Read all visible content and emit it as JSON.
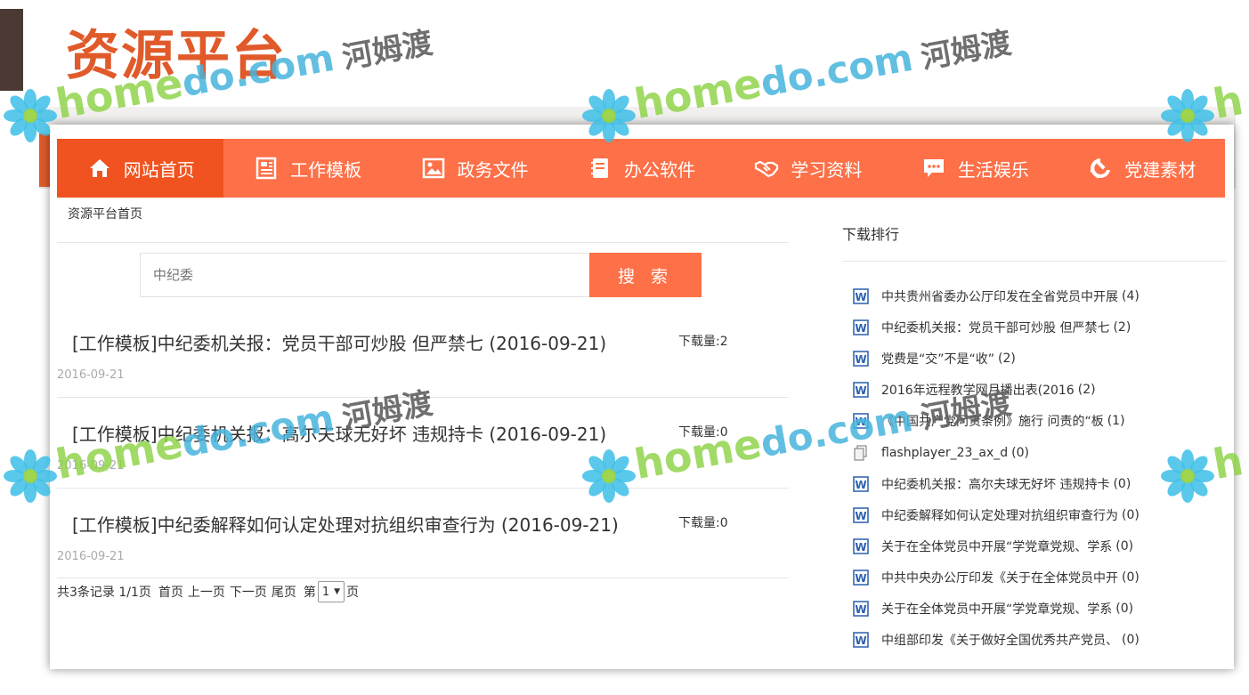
{
  "slide": {
    "title": "资源平台"
  },
  "nav": [
    {
      "label": "网站首页",
      "icon": "home-icon"
    },
    {
      "label": "工作模板",
      "icon": "document-icon"
    },
    {
      "label": "政务文件",
      "icon": "image-icon"
    },
    {
      "label": "办公软件",
      "icon": "notebook-icon"
    },
    {
      "label": "学习资料",
      "icon": "handshake-icon"
    },
    {
      "label": "生活娱乐",
      "icon": "chat-icon"
    },
    {
      "label": "党建素材",
      "icon": "hammer-sickle-icon"
    }
  ],
  "breadcrumb": "资源平台首页",
  "search": {
    "placeholder": "中纪委",
    "button": "搜 索"
  },
  "results": [
    {
      "title": "[工作模板]中纪委机关报：党员干部可炒股 但严禁七 (2016-09-21)",
      "downloads": "下载量:2",
      "date": "2016-09-21"
    },
    {
      "title": "[工作模板]中纪委机关报：高尔夫球无好坏 违规持卡 (2016-09-21)",
      "downloads": "下载量:0",
      "date": "2016-09-21"
    },
    {
      "title": "[工作模板]中纪委解释如何认定处理对抗组织审查行为 (2016-09-21)",
      "downloads": "下载量:0",
      "date": "2016-09-21"
    }
  ],
  "pager": {
    "summary": "共3条记录 1/1页",
    "first": "首页",
    "prev": "上一页",
    "next": "下一页",
    "last": "尾页",
    "goto_prefix": "第",
    "page_value": "1",
    "goto_suffix": "页"
  },
  "sidebar": {
    "title": "下载排行",
    "items": [
      {
        "title": "中共贵州省委办公厅印发在全省党员中开展",
        "count": "(4)",
        "icon": "word-doc-icon"
      },
      {
        "title": "中纪委机关报：党员干部可炒股 但严禁七",
        "count": "(2)",
        "icon": "word-doc-icon"
      },
      {
        "title": "党费是“交”不是“收”",
        "count": "(2)",
        "icon": "word-doc-icon"
      },
      {
        "title": "2016年远程教学网月播出表(2016",
        "count": "(2)",
        "icon": "word-doc-icon"
      },
      {
        "title": "《中国共产党问责条例》施行 问责的“板",
        "count": "(1)",
        "icon": "word-doc-icon"
      },
      {
        "title": "flashplayer_23_ax_d",
        "count": "(0)",
        "icon": "file-icon"
      },
      {
        "title": "中纪委机关报：高尔夫球无好坏 违规持卡",
        "count": "(0)",
        "icon": "word-doc-icon"
      },
      {
        "title": "中纪委解释如何认定处理对抗组织审查行为",
        "count": "(0)",
        "icon": "word-doc-icon"
      },
      {
        "title": "关于在全体党员中开展“学党章党规、学系",
        "count": "(0)",
        "icon": "word-doc-icon"
      },
      {
        "title": "中共中央办公厅印发《关于在全体党员中开",
        "count": "(0)",
        "icon": "word-doc-icon"
      },
      {
        "title": "关于在全体党员中开展“学党章党规、学系",
        "count": "(0)",
        "icon": "word-doc-icon"
      },
      {
        "title": "中组部印发《关于做好全国优秀共产党员、",
        "count": "(0)",
        "icon": "word-doc-icon"
      }
    ]
  },
  "watermark": {
    "en": "home",
    "dom": "do.com",
    "cn": "河姆渡"
  },
  "colors": {
    "nav_bg": "#fd7048",
    "nav_active": "#f0531f",
    "title_accent": "#e05a2a"
  }
}
